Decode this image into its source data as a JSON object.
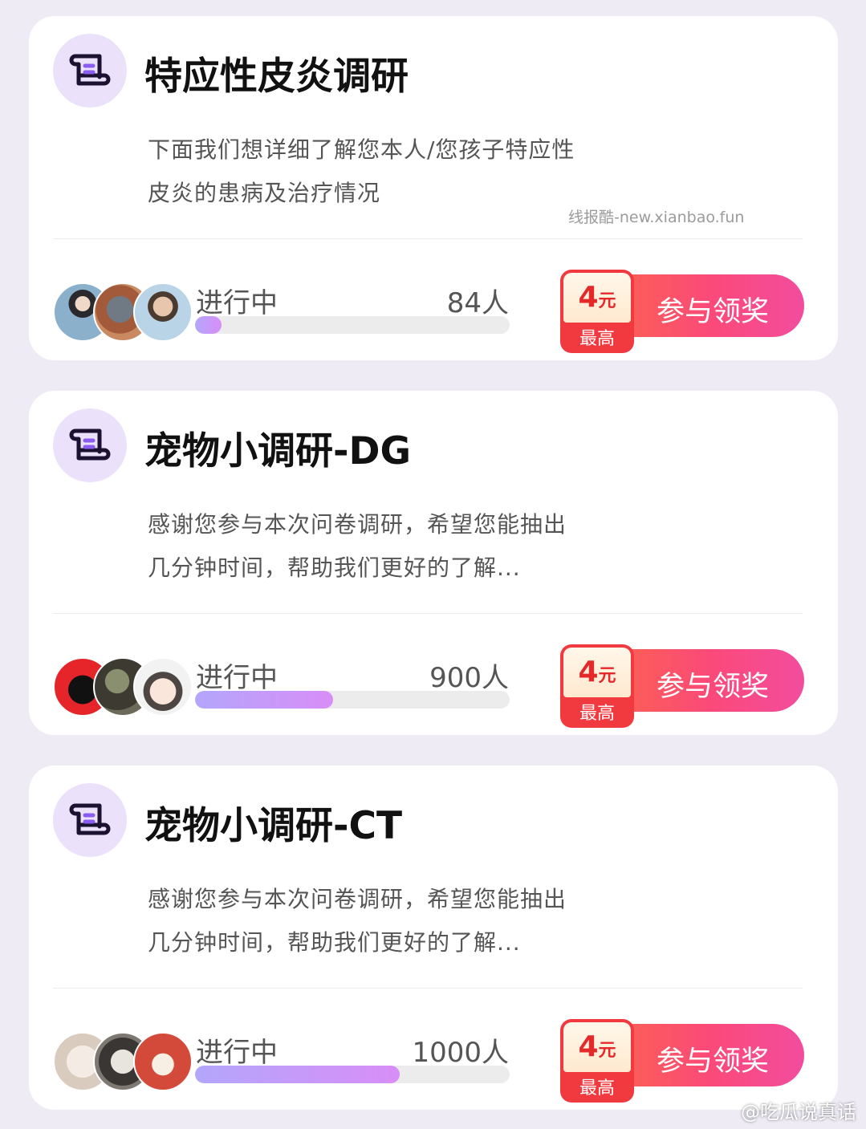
{
  "watermark": "线报酷-new.xianbao.fun",
  "footer": "@吃瓜说真话",
  "colors": {
    "page_bg": "#eeebf5",
    "accent_purple": "#ece1fb",
    "cta_gradient_start": "#fb6b3f",
    "cta_gradient_end": "#f24c9e",
    "reward_red": "#f03a3f",
    "progress_fill": "#c59af9"
  },
  "surveys": [
    {
      "title": "特应性皮炎调研",
      "description": "下面我们想详细了解您本人/您孩子特应性皮炎的患病及治疗情况",
      "status": "进行中",
      "participants": "84人",
      "progress_fraction": 0.085,
      "reward_amount": "4",
      "reward_unit": "元",
      "reward_label": "最高",
      "cta": "参与领奖",
      "avatars": [
        "avatar-user-1",
        "avatar-user-2",
        "avatar-user-3"
      ]
    },
    {
      "title": "宠物小调研-DG",
      "description": "感谢您参与本次问卷调研，希望您能抽出几分钟时间，帮助我们更好的了解...",
      "status": "进行中",
      "participants": "900人",
      "progress_fraction": 0.44,
      "reward_amount": "4",
      "reward_unit": "元",
      "reward_label": "最高",
      "cta": "参与领奖",
      "avatars": [
        "avatar-user-1",
        "avatar-user-2",
        "avatar-user-3"
      ]
    },
    {
      "title": "宠物小调研-CT",
      "description": "感谢您参与本次问卷调研，希望您能抽出几分钟时间，帮助我们更好的了解...",
      "status": "进行中",
      "participants": "1000人",
      "progress_fraction": 0.65,
      "reward_amount": "4",
      "reward_unit": "元",
      "reward_label": "最高",
      "cta": "参与领奖",
      "avatars": [
        "avatar-user-1",
        "avatar-user-2",
        "avatar-user-3"
      ]
    }
  ]
}
